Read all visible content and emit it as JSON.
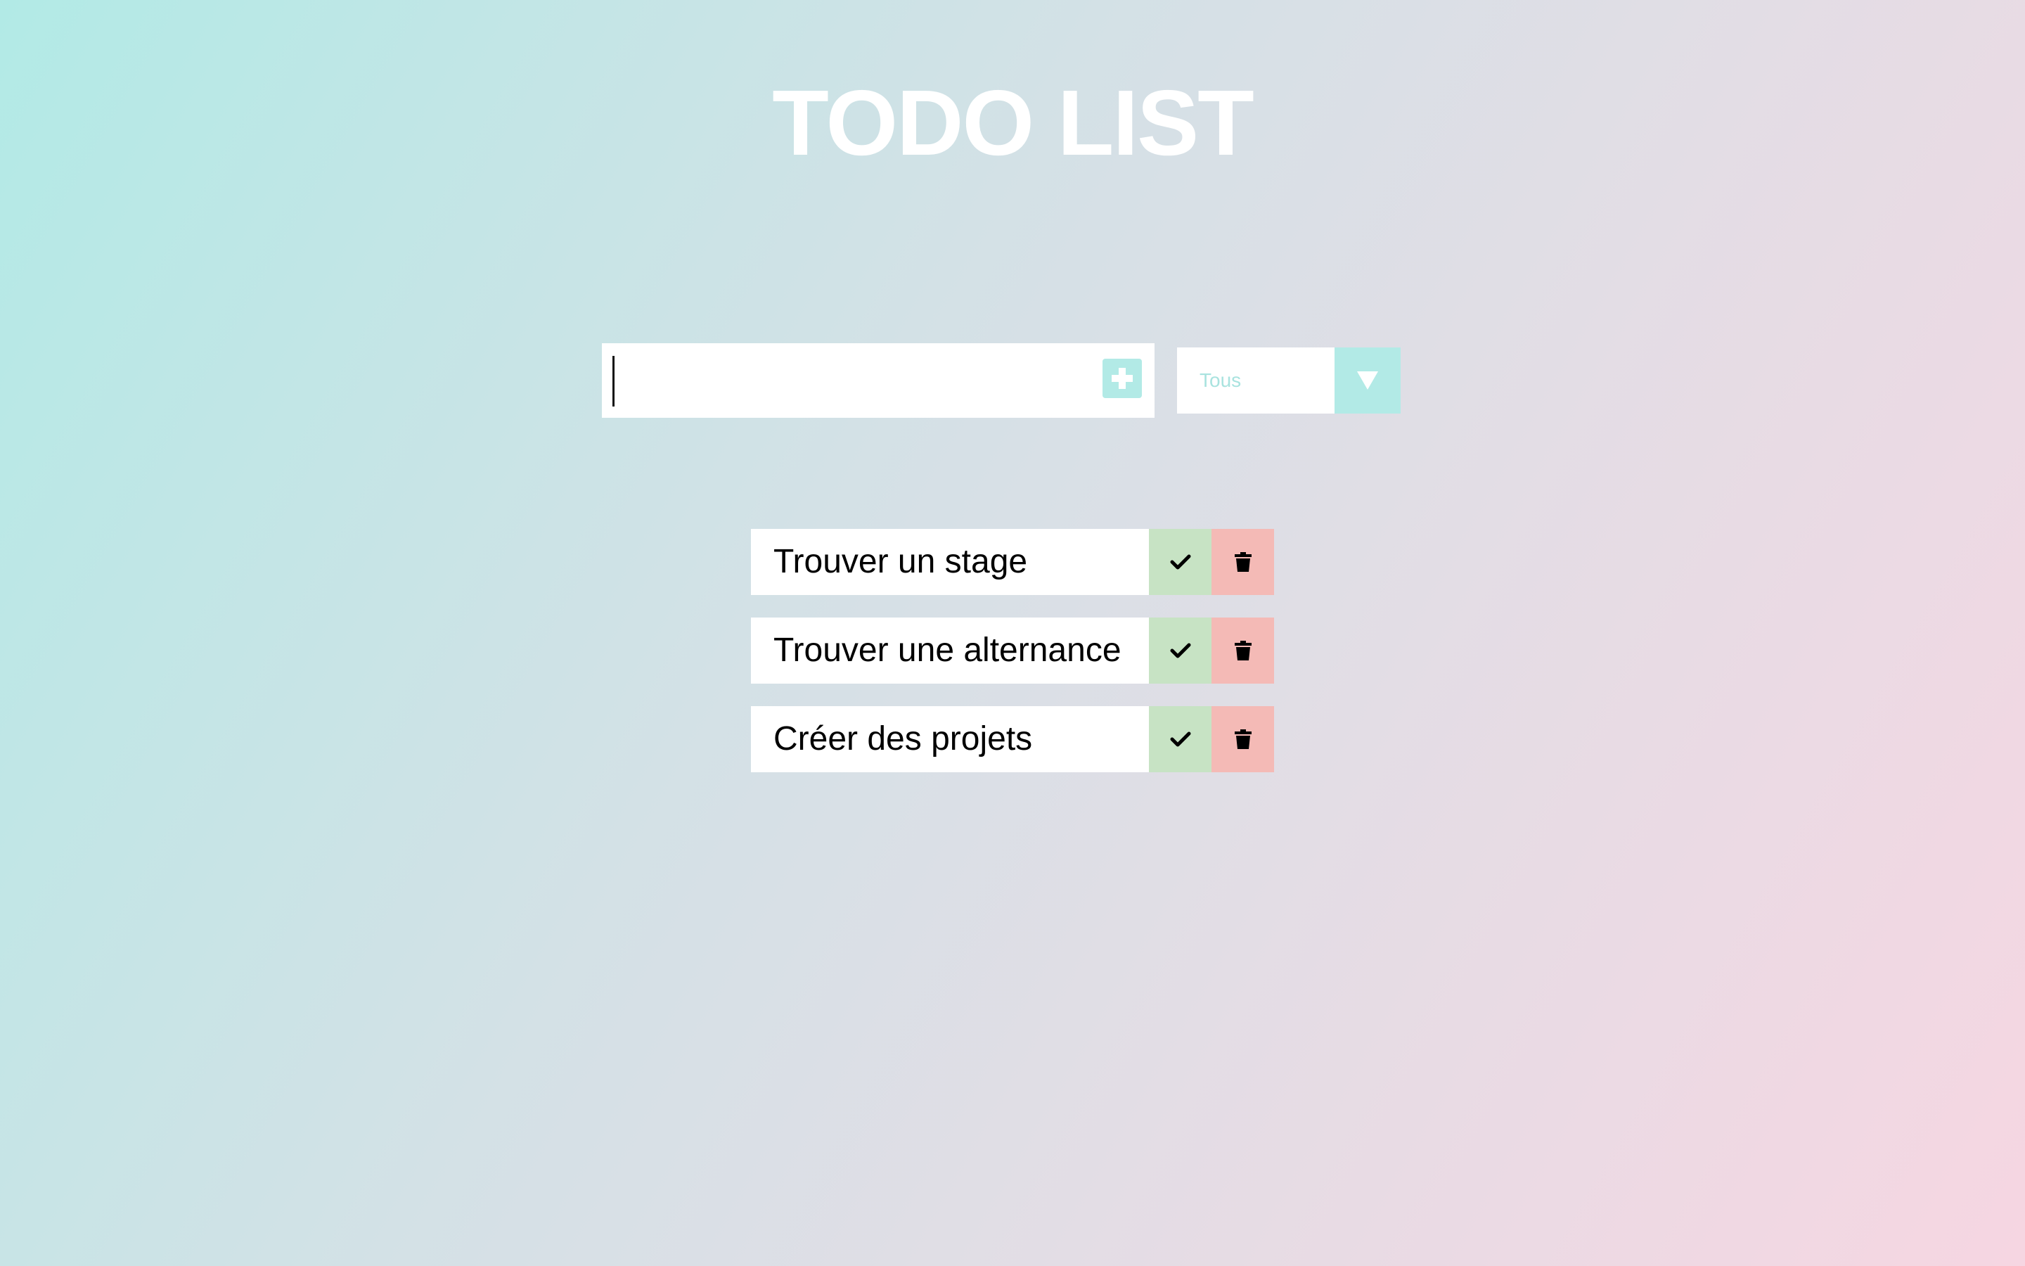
{
  "header": {
    "title": "TODO LIST"
  },
  "add_form": {
    "input_value": "",
    "add_icon": "plus-icon"
  },
  "filter": {
    "selected": "Tous",
    "arrow_icon": "triangle-down-icon"
  },
  "todos": [
    {
      "label": "Trouver un stage",
      "complete_icon": "check-icon",
      "delete_icon": "trash-icon"
    },
    {
      "label": "Trouver une alternance",
      "complete_icon": "check-icon",
      "delete_icon": "trash-icon"
    },
    {
      "label": "Créer des projets",
      "complete_icon": "check-icon",
      "delete_icon": "trash-icon"
    }
  ],
  "colors": {
    "accent": "#b2eae6",
    "complete": "#c7e3c4",
    "delete": "#f4bab6",
    "background_start": "#b2eae6",
    "background_end": "#f6d6e2"
  }
}
